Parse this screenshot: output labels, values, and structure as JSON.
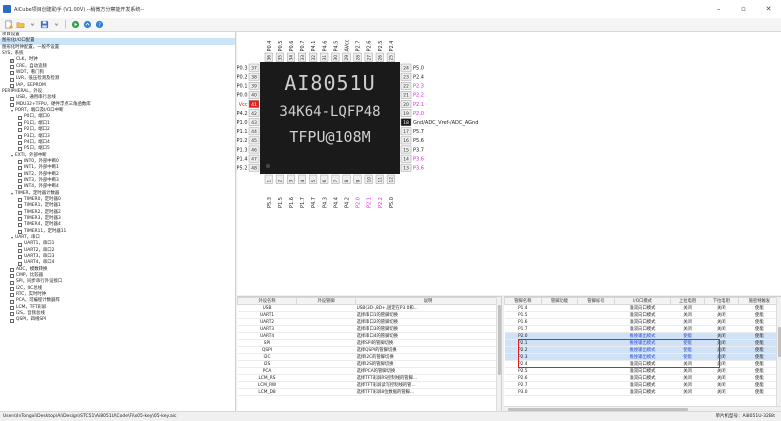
{
  "window": {
    "title": "AiCube项目创建助手 (V1.00V) --稍微方分察能开发系统--",
    "minimize": "–",
    "maximize": "▫",
    "close": "✕"
  },
  "colors": {
    "pin_red": "#e02020",
    "pin_magenta": "#e020e0",
    "selection": "#cfe2f7",
    "highlight_box": "#e02020",
    "chip_body": "#1a1a1a"
  },
  "toolbar": {
    "icons": [
      "new-file-icon",
      "open-folder-icon",
      "save-icon",
      "run-icon",
      "share-icon",
      "help-icon"
    ]
  },
  "tree": [
    {
      "text": "项目设置",
      "indent": 0,
      "cb": "none",
      "sel": false
    },
    {
      "text": "图形化I/O口配置",
      "indent": 0,
      "cb": "none",
      "sel": true
    },
    {
      "text": "图形化时钟配置，一般不设置",
      "indent": 0,
      "cb": "none",
      "sel": false
    },
    {
      "text": "SYS，系统",
      "indent": 0,
      "cb": "none",
      "sel": false
    },
    {
      "text": "CLK，时钟",
      "indent": 1,
      "cb": "checked",
      "sel": false
    },
    {
      "text": "CRE，自动追频",
      "indent": 1,
      "cb": "empty",
      "sel": false
    },
    {
      "text": "WDT，看门狗",
      "indent": 1,
      "cb": "empty",
      "sel": false
    },
    {
      "text": "LVR，低压检测及检测",
      "indent": 1,
      "cb": "empty",
      "sel": false
    },
    {
      "text": "IAP，EEPROM",
      "indent": 1,
      "cb": "empty",
      "sel": false
    },
    {
      "text": "PERIPHERAL，外设",
      "indent": 0,
      "cb": "none",
      "sel": false
    },
    {
      "text": "USB，通用串行总线",
      "indent": 1,
      "cb": "empty",
      "sel": false
    },
    {
      "text": "MDU32+TFPU，硬件浮点三角函数库",
      "indent": 1,
      "cb": "empty",
      "sel": false
    },
    {
      "text": "PORT，端口及I/O口中断",
      "indent": 1,
      "cb": "none",
      "sel": false,
      "exp": true
    },
    {
      "text": "P0口，端口0",
      "indent": 2,
      "cb": "empty",
      "sel": false
    },
    {
      "text": "P1口，端口1",
      "indent": 2,
      "cb": "empty",
      "sel": false
    },
    {
      "text": "P2口，端口2",
      "indent": 2,
      "cb": "empty",
      "sel": false
    },
    {
      "text": "P3口，端口3",
      "indent": 2,
      "cb": "empty",
      "sel": false
    },
    {
      "text": "P4口，端口4",
      "indent": 2,
      "cb": "empty",
      "sel": false
    },
    {
      "text": "P5口，端口5",
      "indent": 2,
      "cb": "empty",
      "sel": false
    },
    {
      "text": "EXTI，外部中断",
      "indent": 1,
      "cb": "none",
      "sel": false,
      "exp": true
    },
    {
      "text": "INT0，外部中断0",
      "indent": 2,
      "cb": "empty",
      "sel": false
    },
    {
      "text": "INT1，外部中断1",
      "indent": 2,
      "cb": "empty",
      "sel": false
    },
    {
      "text": "INT2，外部中断2",
      "indent": 2,
      "cb": "empty",
      "sel": false
    },
    {
      "text": "INT3，外部中断3",
      "indent": 2,
      "cb": "empty",
      "sel": false
    },
    {
      "text": "INT4，外部中断4",
      "indent": 2,
      "cb": "empty",
      "sel": false
    },
    {
      "text": "TIMER，定时器计数器",
      "indent": 1,
      "cb": "none",
      "sel": false,
      "exp": true
    },
    {
      "text": "TIMER0，定时器0",
      "indent": 2,
      "cb": "empty",
      "sel": false
    },
    {
      "text": "TIMER1，定时器1",
      "indent": 2,
      "cb": "empty",
      "sel": false
    },
    {
      "text": "TIMER2，定时器2",
      "indent": 2,
      "cb": "empty",
      "sel": false
    },
    {
      "text": "TIMER3，定时器3",
      "indent": 2,
      "cb": "empty",
      "sel": false
    },
    {
      "text": "TIMER4，定时器4",
      "indent": 2,
      "cb": "empty",
      "sel": false
    },
    {
      "text": "TIMER11，定时器11",
      "indent": 2,
      "cb": "empty",
      "sel": false
    },
    {
      "text": "UART，串口",
      "indent": 1,
      "cb": "none",
      "sel": false,
      "exp": true
    },
    {
      "text": "UART1，串口1",
      "indent": 2,
      "cb": "empty",
      "sel": false
    },
    {
      "text": "UART2，串口2",
      "indent": 2,
      "cb": "empty",
      "sel": false
    },
    {
      "text": "UART3，串口3",
      "indent": 2,
      "cb": "empty",
      "sel": false
    },
    {
      "text": "UART4，串口4",
      "indent": 2,
      "cb": "empty",
      "sel": false
    },
    {
      "text": "ADC，模数转换",
      "indent": 1,
      "cb": "empty",
      "sel": false
    },
    {
      "text": "CMP，比较器",
      "indent": 1,
      "cb": "empty",
      "sel": false
    },
    {
      "text": "SPI，同步串行外设接口",
      "indent": 1,
      "cb": "empty",
      "sel": false
    },
    {
      "text": "I2C，IIC总线",
      "indent": 1,
      "cb": "empty",
      "sel": false
    },
    {
      "text": "RTC，实时时钟",
      "indent": 1,
      "cb": "empty",
      "sel": false
    },
    {
      "text": "PCA，可编程计数器阵",
      "indent": 1,
      "cb": "empty",
      "sel": false
    },
    {
      "text": "LCM，TFT彩屏",
      "indent": 1,
      "cb": "empty",
      "sel": false
    },
    {
      "text": "I2S，音频总线",
      "indent": 1,
      "cb": "empty",
      "sel": false
    },
    {
      "text": "QSPI，四线SPI",
      "indent": 1,
      "cb": "empty",
      "sel": false
    }
  ],
  "chip": {
    "line1": "AI8051U",
    "line2": "34K64-LQFP48",
    "line3": "TFPU@108M",
    "top_pins": [
      {
        "n": "36",
        "label": "P0.4"
      },
      {
        "n": "35",
        "label": "P0.5"
      },
      {
        "n": "34",
        "label": "P0.6"
      },
      {
        "n": "33",
        "label": "P0.7"
      },
      {
        "n": "32",
        "label": "P4.1"
      },
      {
        "n": "31",
        "label": "P4.6"
      },
      {
        "n": "30",
        "label": "P4.5"
      },
      {
        "n": "29",
        "label": "AVcc"
      },
      {
        "n": "28",
        "label": "P2.7"
      },
      {
        "n": "27",
        "label": "P2.6"
      },
      {
        "n": "26",
        "label": "P2.5"
      },
      {
        "n": "25",
        "label": "P2.4"
      }
    ],
    "bottom_pins": [
      {
        "n": "1",
        "label": "P5.3",
        "hl": ""
      },
      {
        "n": "2",
        "label": "P1.5",
        "hl": ""
      },
      {
        "n": "3",
        "label": "P1.6",
        "hl": ""
      },
      {
        "n": "4",
        "label": "P1.7",
        "hl": ""
      },
      {
        "n": "5",
        "label": "P4.7",
        "hl": ""
      },
      {
        "n": "6",
        "label": "P4.3",
        "hl": ""
      },
      {
        "n": "7",
        "label": "P4.4",
        "hl": ""
      },
      {
        "n": "8",
        "label": "P4.2",
        "hl": ""
      },
      {
        "n": "9",
        "label": "P2.0",
        "hl": "m"
      },
      {
        "n": "10",
        "label": "P2.1",
        "hl": "m"
      },
      {
        "n": "11",
        "label": "P2.2",
        "hl": "m"
      },
      {
        "n": "12",
        "label": "P5.0",
        "hl": ""
      }
    ],
    "left_pins": [
      {
        "n": "37",
        "label": "P0.3",
        "hl": ""
      },
      {
        "n": "38",
        "label": "P0.2",
        "hl": ""
      },
      {
        "n": "39",
        "label": "P0.1",
        "hl": ""
      },
      {
        "n": "40",
        "label": "P0.0",
        "hl": ""
      },
      {
        "n": "41",
        "label": "Vcc",
        "hl": "r"
      },
      {
        "n": "42",
        "label": "P4.2",
        "hl": ""
      },
      {
        "n": "43",
        "label": "P1.0",
        "hl": ""
      },
      {
        "n": "44",
        "label": "P1.1",
        "hl": ""
      },
      {
        "n": "45",
        "label": "P1.2",
        "hl": ""
      },
      {
        "n": "46",
        "label": "P1.3",
        "hl": ""
      },
      {
        "n": "47",
        "label": "P1.4",
        "hl": ""
      },
      {
        "n": "48",
        "label": "P5.2",
        "hl": ""
      }
    ],
    "right_pins": [
      {
        "n": "24",
        "label": "P5.0",
        "hl": ""
      },
      {
        "n": "23",
        "label": "P2.4",
        "hl": ""
      },
      {
        "n": "22",
        "label": "P2.3",
        "hl": "m"
      },
      {
        "n": "21",
        "label": "P2.2",
        "hl": "m"
      },
      {
        "n": "20",
        "label": "P2.1",
        "hl": "m"
      },
      {
        "n": "19",
        "label": "P2.0",
        "hl": "m"
      },
      {
        "n": "18",
        "label": "Gnd/ADC_Vref-/ADC_AGnd",
        "hl": "k"
      },
      {
        "n": "17",
        "label": "P5.7",
        "hl": ""
      },
      {
        "n": "16",
        "label": "P5.6",
        "hl": ""
      },
      {
        "n": "15",
        "label": "P3.7",
        "hl": ""
      },
      {
        "n": "14",
        "label": "P3.6",
        "hl": "m"
      },
      {
        "n": "13",
        "label": "P3.6",
        "hl": "m"
      }
    ]
  },
  "periph_table": {
    "headers": [
      "外设名称",
      "外设管脚",
      "说明"
    ],
    "rows": [
      [
        "USB",
        "",
        "USB(3D-,8D+,固定在P3.0和..."
      ],
      [
        "UART1",
        "",
        "选择串口1的管脚切换"
      ],
      [
        "UART2",
        "",
        "选择串口2的管脚切换"
      ],
      [
        "UART3",
        "",
        "选择串口3的管脚切换"
      ],
      [
        "UART4",
        "",
        "选择串口4的管脚切换"
      ],
      [
        "SPI",
        "",
        "选择SPI的管脚切换"
      ],
      [
        "QSPI",
        "",
        "选择QSPI的管脚切换"
      ],
      [
        "I2C",
        "",
        "选择I2C的管脚切换"
      ],
      [
        "I2S",
        "",
        "选择I2S的管脚切换"
      ],
      [
        "PCA",
        "",
        "选择PCA的管脚切换"
      ],
      [
        "LCM_RS",
        "",
        "选择TFT彩屏RS控制线的管脚..."
      ],
      [
        "LCM_RW",
        "",
        "选择TFT彩屏读写控制线的管..."
      ],
      [
        "LCM_D8",
        "",
        "选择TFT彩屏8位数据的管脚..."
      ]
    ]
  },
  "pin_table": {
    "headers": [
      "管脚名称",
      "管脚功能",
      "管脚标号",
      "I/O口模式",
      "上拉电阻",
      "下拉电阻",
      "施密特触发"
    ],
    "rows": [
      {
        "cells": [
          "P1.4",
          "",
          "",
          "准双向口模式",
          "关闭",
          "关闭",
          "使能"
        ],
        "sel": false
      },
      {
        "cells": [
          "P1.5",
          "",
          "",
          "准双向口模式",
          "关闭",
          "关闭",
          "使能"
        ],
        "sel": false
      },
      {
        "cells": [
          "P1.6",
          "",
          "",
          "准双向口模式",
          "关闭",
          "关闭",
          "使能"
        ],
        "sel": false
      },
      {
        "cells": [
          "P1.7",
          "",
          "",
          "准双向口模式",
          "关闭",
          "关闭",
          "使能"
        ],
        "sel": false
      },
      {
        "cells": [
          "P2.0",
          "",
          "",
          "推挽输出模式",
          "使能",
          "关闭",
          "使能"
        ],
        "sel": true
      },
      {
        "cells": [
          "P2.1",
          "",
          "",
          "推挽输出模式",
          "使能",
          "关闭",
          "使能"
        ],
        "sel": true
      },
      {
        "cells": [
          "P2.2",
          "",
          "",
          "推挽输出模式",
          "使能",
          "关闭",
          "使能"
        ],
        "sel": true
      },
      {
        "cells": [
          "P2.3",
          "",
          "",
          "推挽输出模式",
          "使能",
          "关闭",
          "使能"
        ],
        "sel": true
      },
      {
        "cells": [
          "P2.4",
          "",
          "",
          "准双向口模式",
          "关闭",
          "关闭",
          "使能"
        ],
        "sel": false
      },
      {
        "cells": [
          "P2.5",
          "",
          "",
          "准双向口模式",
          "关闭",
          "关闭",
          "使能"
        ],
        "sel": false
      },
      {
        "cells": [
          "P2.6",
          "",
          "",
          "准双向口模式",
          "关闭",
          "关闭",
          "使能"
        ],
        "sel": false
      },
      {
        "cells": [
          "P2.7",
          "",
          "",
          "准双向口模式",
          "关闭",
          "关闭",
          "使能"
        ],
        "sel": false
      },
      {
        "cells": [
          "P3.0",
          "",
          "",
          "准双向口模式",
          "关闭",
          "关闭",
          "使能"
        ],
        "sel": false
      }
    ]
  },
  "status": {
    "path": "Users\\InTongxi\\Desktop\\Ai\\Design\\STC51\\Ai8051U\\Code\\Fi\\x05-key\\05-key.aic",
    "mcu": "单片机型号：Ai8051U-32Bit"
  }
}
